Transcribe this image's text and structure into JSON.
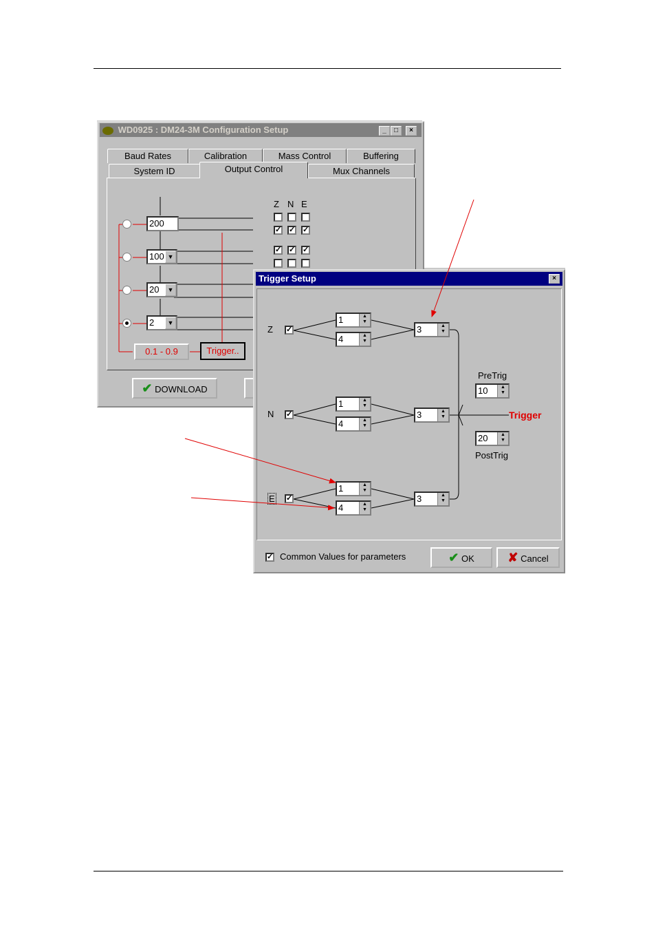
{
  "config_window": {
    "title": "WD0925 : DM24-3M Configuration Setup",
    "tabs_row1": [
      "Baud Rates",
      "Calibration",
      "Mass Control",
      "Buffering"
    ],
    "tabs_row2": [
      "System ID",
      "Output Control",
      "Mux Channels"
    ],
    "channel_headers": [
      "Z",
      "N",
      "E"
    ],
    "rates": [
      {
        "value": "200",
        "dropdown": false
      },
      {
        "value": "100",
        "dropdown": true
      },
      {
        "value": "20",
        "dropdown": true
      },
      {
        "value": "2",
        "dropdown": true
      }
    ],
    "range_button": "0.1 - 0.9",
    "trigger_button": "Trigger..",
    "download_button": "DOWNLOAD",
    "selected_rate_index": 3
  },
  "trigger_dialog": {
    "title": "Trigger Setup",
    "channels": [
      {
        "label": "Z",
        "upper": "1",
        "lower": "4",
        "result": "3",
        "checked": true
      },
      {
        "label": "N",
        "upper": "1",
        "lower": "4",
        "result": "3",
        "checked": true
      },
      {
        "label": "E",
        "upper": "1",
        "lower": "4",
        "result": "3",
        "checked": true
      }
    ],
    "pretrig_label": "PreTrig",
    "pretrig_value": "10",
    "posttrig_label": "PostTrig",
    "posttrig_value": "20",
    "trigger_label": "Trigger",
    "common_values_label": "Common Values for parameters",
    "common_values_checked": true,
    "ok_button": "OK",
    "cancel_button": "Cancel"
  },
  "colors": {
    "annotation": "#e00000",
    "title_active": "#000080",
    "title_inactive": "#808080"
  }
}
